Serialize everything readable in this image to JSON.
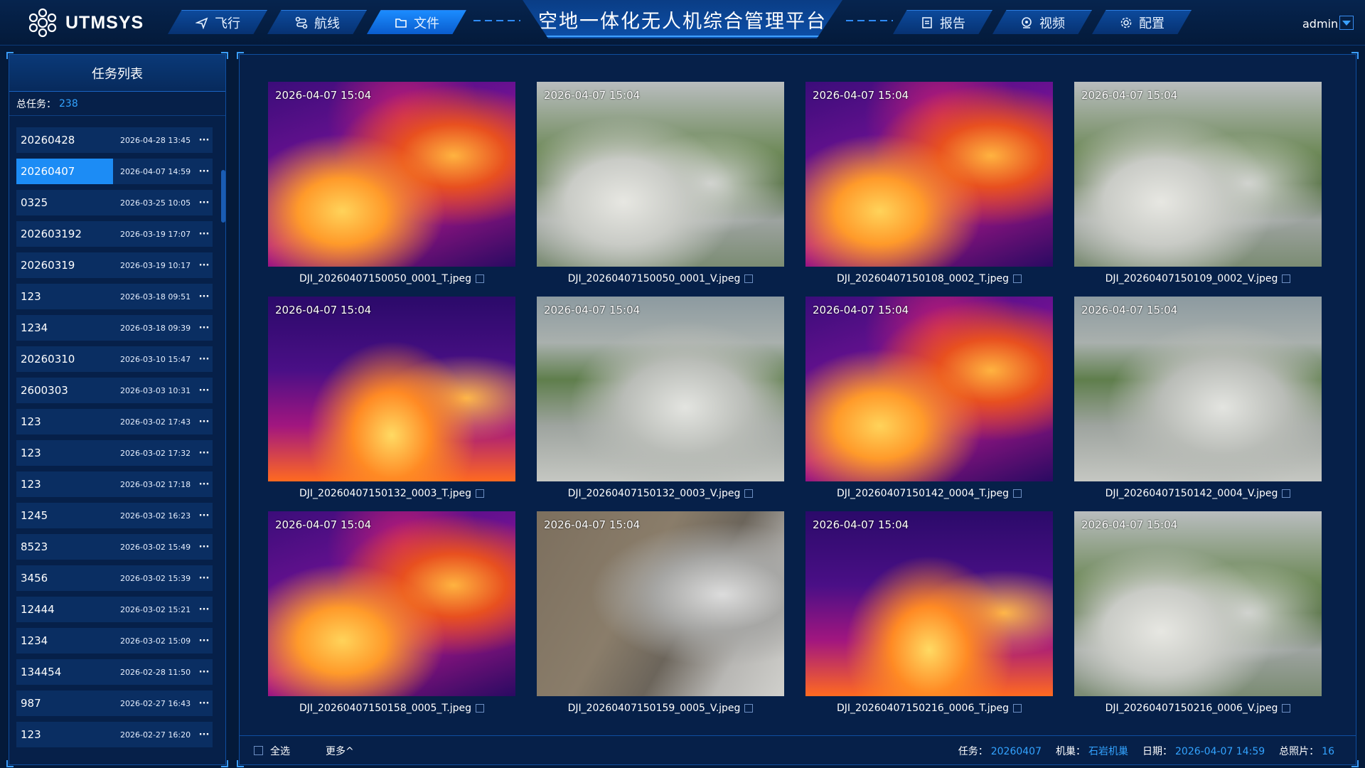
{
  "brand": {
    "name": "UTMSYS"
  },
  "title": "空地一体化无人机综合管理平台",
  "nav_left": [
    {
      "label": "飞行",
      "icon": "plane-icon",
      "active": false
    },
    {
      "label": "航线",
      "icon": "route-icon",
      "active": false
    },
    {
      "label": "文件",
      "icon": "folder-icon",
      "active": true
    }
  ],
  "nav_right": [
    {
      "label": "报告",
      "icon": "report-icon"
    },
    {
      "label": "视频",
      "icon": "video-icon"
    },
    {
      "label": "配置",
      "icon": "gear-icon"
    }
  ],
  "user": "admin",
  "sidebar": {
    "title": "任务列表",
    "total_label": "总任务：",
    "total": "238",
    "tasks": [
      {
        "name": "20260428",
        "date": "2026-04-28 13:45"
      },
      {
        "name": "20260407",
        "date": "2026-04-07 14:59",
        "active": true
      },
      {
        "name": "0325",
        "date": "2026-03-25 10:05"
      },
      {
        "name": "202603192",
        "date": "2026-03-19 17:07"
      },
      {
        "name": "20260319",
        "date": "2026-03-19 10:17"
      },
      {
        "name": "123",
        "date": "2026-03-18 09:51"
      },
      {
        "name": "1234",
        "date": "2026-03-18 09:39"
      },
      {
        "name": "20260310",
        "date": "2026-03-10 15:47"
      },
      {
        "name": "2600303",
        "date": "2026-03-03 10:31"
      },
      {
        "name": "123",
        "date": "2026-03-02 17:43"
      },
      {
        "name": "123",
        "date": "2026-03-02 17:32"
      },
      {
        "name": "123",
        "date": "2026-03-02 17:18"
      },
      {
        "name": "1245",
        "date": "2026-03-02 16:23"
      },
      {
        "name": "8523",
        "date": "2026-03-02 15:49"
      },
      {
        "name": "3456",
        "date": "2026-03-02 15:39"
      },
      {
        "name": "12444",
        "date": "2026-03-02 15:21"
      },
      {
        "name": "1234",
        "date": "2026-03-02 15:09"
      },
      {
        "name": "134454",
        "date": "2026-02-28 11:50"
      },
      {
        "name": "987",
        "date": "2026-02-27 16:43"
      },
      {
        "name": "123",
        "date": "2026-02-27 16:20"
      }
    ],
    "more_symbol": "···"
  },
  "files": [
    {
      "name": "DJI_20260407150050_0001_T.jpeg",
      "timestamp": "2026-04-07 15:04",
      "kind": "thermal"
    },
    {
      "name": "DJI_20260407150050_0001_V.jpeg",
      "timestamp": "2026-04-07 15:04",
      "kind": "visible"
    },
    {
      "name": "DJI_20260407150108_0002_T.jpeg",
      "timestamp": "2026-04-07 15:04",
      "kind": "thermal"
    },
    {
      "name": "DJI_20260407150109_0002_V.jpeg",
      "timestamp": "2026-04-07 15:04",
      "kind": "visible"
    },
    {
      "name": "DJI_20260407150132_0003_T.jpeg",
      "timestamp": "2026-04-07 15:04",
      "kind": "thermal"
    },
    {
      "name": "DJI_20260407150132_0003_V.jpeg",
      "timestamp": "2026-04-07 15:04",
      "kind": "visible"
    },
    {
      "name": "DJI_20260407150142_0004_T.jpeg",
      "timestamp": "2026-04-07 15:04",
      "kind": "thermal"
    },
    {
      "name": "DJI_20260407150142_0004_V.jpeg",
      "timestamp": "2026-04-07 15:04",
      "kind": "visible"
    },
    {
      "name": "DJI_20260407150158_0005_T.jpeg",
      "timestamp": "2026-04-07 15:04",
      "kind": "thermal"
    },
    {
      "name": "DJI_20260407150159_0005_V.jpeg",
      "timestamp": "2026-04-07 15:04",
      "kind": "visible"
    },
    {
      "name": "DJI_20260407150216_0006_T.jpeg",
      "timestamp": "2026-04-07 15:04",
      "kind": "thermal"
    },
    {
      "name": "DJI_20260407150216_0006_V.jpeg",
      "timestamp": "2026-04-07 15:04",
      "kind": "visible"
    }
  ],
  "footer": {
    "select_all": "全选",
    "more": "更多^",
    "task_label": "任务：",
    "task_value": "20260407",
    "dock_label": "机巢：",
    "dock_value": "石岩机巢",
    "date_label": "日期：",
    "date_value": "2026-04-07 14:59",
    "total_label": "总照片：",
    "total_value": "16"
  }
}
